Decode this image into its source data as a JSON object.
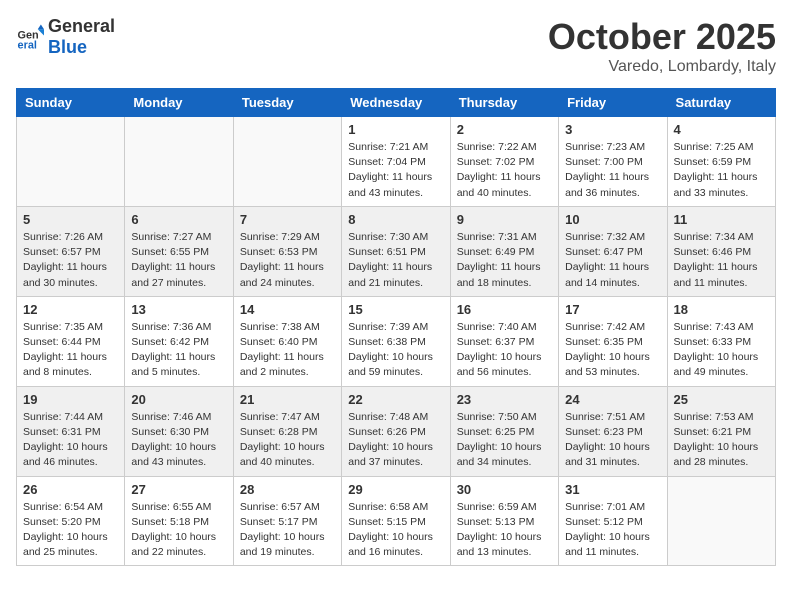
{
  "header": {
    "logo_general": "General",
    "logo_blue": "Blue",
    "month": "October 2025",
    "location": "Varedo, Lombardy, Italy"
  },
  "weekdays": [
    "Sunday",
    "Monday",
    "Tuesday",
    "Wednesday",
    "Thursday",
    "Friday",
    "Saturday"
  ],
  "weeks": [
    [
      {
        "day": "",
        "info": ""
      },
      {
        "day": "",
        "info": ""
      },
      {
        "day": "",
        "info": ""
      },
      {
        "day": "1",
        "info": "Sunrise: 7:21 AM\nSunset: 7:04 PM\nDaylight: 11 hours\nand 43 minutes."
      },
      {
        "day": "2",
        "info": "Sunrise: 7:22 AM\nSunset: 7:02 PM\nDaylight: 11 hours\nand 40 minutes."
      },
      {
        "day": "3",
        "info": "Sunrise: 7:23 AM\nSunset: 7:00 PM\nDaylight: 11 hours\nand 36 minutes."
      },
      {
        "day": "4",
        "info": "Sunrise: 7:25 AM\nSunset: 6:59 PM\nDaylight: 11 hours\nand 33 minutes."
      }
    ],
    [
      {
        "day": "5",
        "info": "Sunrise: 7:26 AM\nSunset: 6:57 PM\nDaylight: 11 hours\nand 30 minutes."
      },
      {
        "day": "6",
        "info": "Sunrise: 7:27 AM\nSunset: 6:55 PM\nDaylight: 11 hours\nand 27 minutes."
      },
      {
        "day": "7",
        "info": "Sunrise: 7:29 AM\nSunset: 6:53 PM\nDaylight: 11 hours\nand 24 minutes."
      },
      {
        "day": "8",
        "info": "Sunrise: 7:30 AM\nSunset: 6:51 PM\nDaylight: 11 hours\nand 21 minutes."
      },
      {
        "day": "9",
        "info": "Sunrise: 7:31 AM\nSunset: 6:49 PM\nDaylight: 11 hours\nand 18 minutes."
      },
      {
        "day": "10",
        "info": "Sunrise: 7:32 AM\nSunset: 6:47 PM\nDaylight: 11 hours\nand 14 minutes."
      },
      {
        "day": "11",
        "info": "Sunrise: 7:34 AM\nSunset: 6:46 PM\nDaylight: 11 hours\nand 11 minutes."
      }
    ],
    [
      {
        "day": "12",
        "info": "Sunrise: 7:35 AM\nSunset: 6:44 PM\nDaylight: 11 hours\nand 8 minutes."
      },
      {
        "day": "13",
        "info": "Sunrise: 7:36 AM\nSunset: 6:42 PM\nDaylight: 11 hours\nand 5 minutes."
      },
      {
        "day": "14",
        "info": "Sunrise: 7:38 AM\nSunset: 6:40 PM\nDaylight: 11 hours\nand 2 minutes."
      },
      {
        "day": "15",
        "info": "Sunrise: 7:39 AM\nSunset: 6:38 PM\nDaylight: 10 hours\nand 59 minutes."
      },
      {
        "day": "16",
        "info": "Sunrise: 7:40 AM\nSunset: 6:37 PM\nDaylight: 10 hours\nand 56 minutes."
      },
      {
        "day": "17",
        "info": "Sunrise: 7:42 AM\nSunset: 6:35 PM\nDaylight: 10 hours\nand 53 minutes."
      },
      {
        "day": "18",
        "info": "Sunrise: 7:43 AM\nSunset: 6:33 PM\nDaylight: 10 hours\nand 49 minutes."
      }
    ],
    [
      {
        "day": "19",
        "info": "Sunrise: 7:44 AM\nSunset: 6:31 PM\nDaylight: 10 hours\nand 46 minutes."
      },
      {
        "day": "20",
        "info": "Sunrise: 7:46 AM\nSunset: 6:30 PM\nDaylight: 10 hours\nand 43 minutes."
      },
      {
        "day": "21",
        "info": "Sunrise: 7:47 AM\nSunset: 6:28 PM\nDaylight: 10 hours\nand 40 minutes."
      },
      {
        "day": "22",
        "info": "Sunrise: 7:48 AM\nSunset: 6:26 PM\nDaylight: 10 hours\nand 37 minutes."
      },
      {
        "day": "23",
        "info": "Sunrise: 7:50 AM\nSunset: 6:25 PM\nDaylight: 10 hours\nand 34 minutes."
      },
      {
        "day": "24",
        "info": "Sunrise: 7:51 AM\nSunset: 6:23 PM\nDaylight: 10 hours\nand 31 minutes."
      },
      {
        "day": "25",
        "info": "Sunrise: 7:53 AM\nSunset: 6:21 PM\nDaylight: 10 hours\nand 28 minutes."
      }
    ],
    [
      {
        "day": "26",
        "info": "Sunrise: 6:54 AM\nSunset: 5:20 PM\nDaylight: 10 hours\nand 25 minutes."
      },
      {
        "day": "27",
        "info": "Sunrise: 6:55 AM\nSunset: 5:18 PM\nDaylight: 10 hours\nand 22 minutes."
      },
      {
        "day": "28",
        "info": "Sunrise: 6:57 AM\nSunset: 5:17 PM\nDaylight: 10 hours\nand 19 minutes."
      },
      {
        "day": "29",
        "info": "Sunrise: 6:58 AM\nSunset: 5:15 PM\nDaylight: 10 hours\nand 16 minutes."
      },
      {
        "day": "30",
        "info": "Sunrise: 6:59 AM\nSunset: 5:13 PM\nDaylight: 10 hours\nand 13 minutes."
      },
      {
        "day": "31",
        "info": "Sunrise: 7:01 AM\nSunset: 5:12 PM\nDaylight: 10 hours\nand 11 minutes."
      },
      {
        "day": "",
        "info": ""
      }
    ]
  ]
}
